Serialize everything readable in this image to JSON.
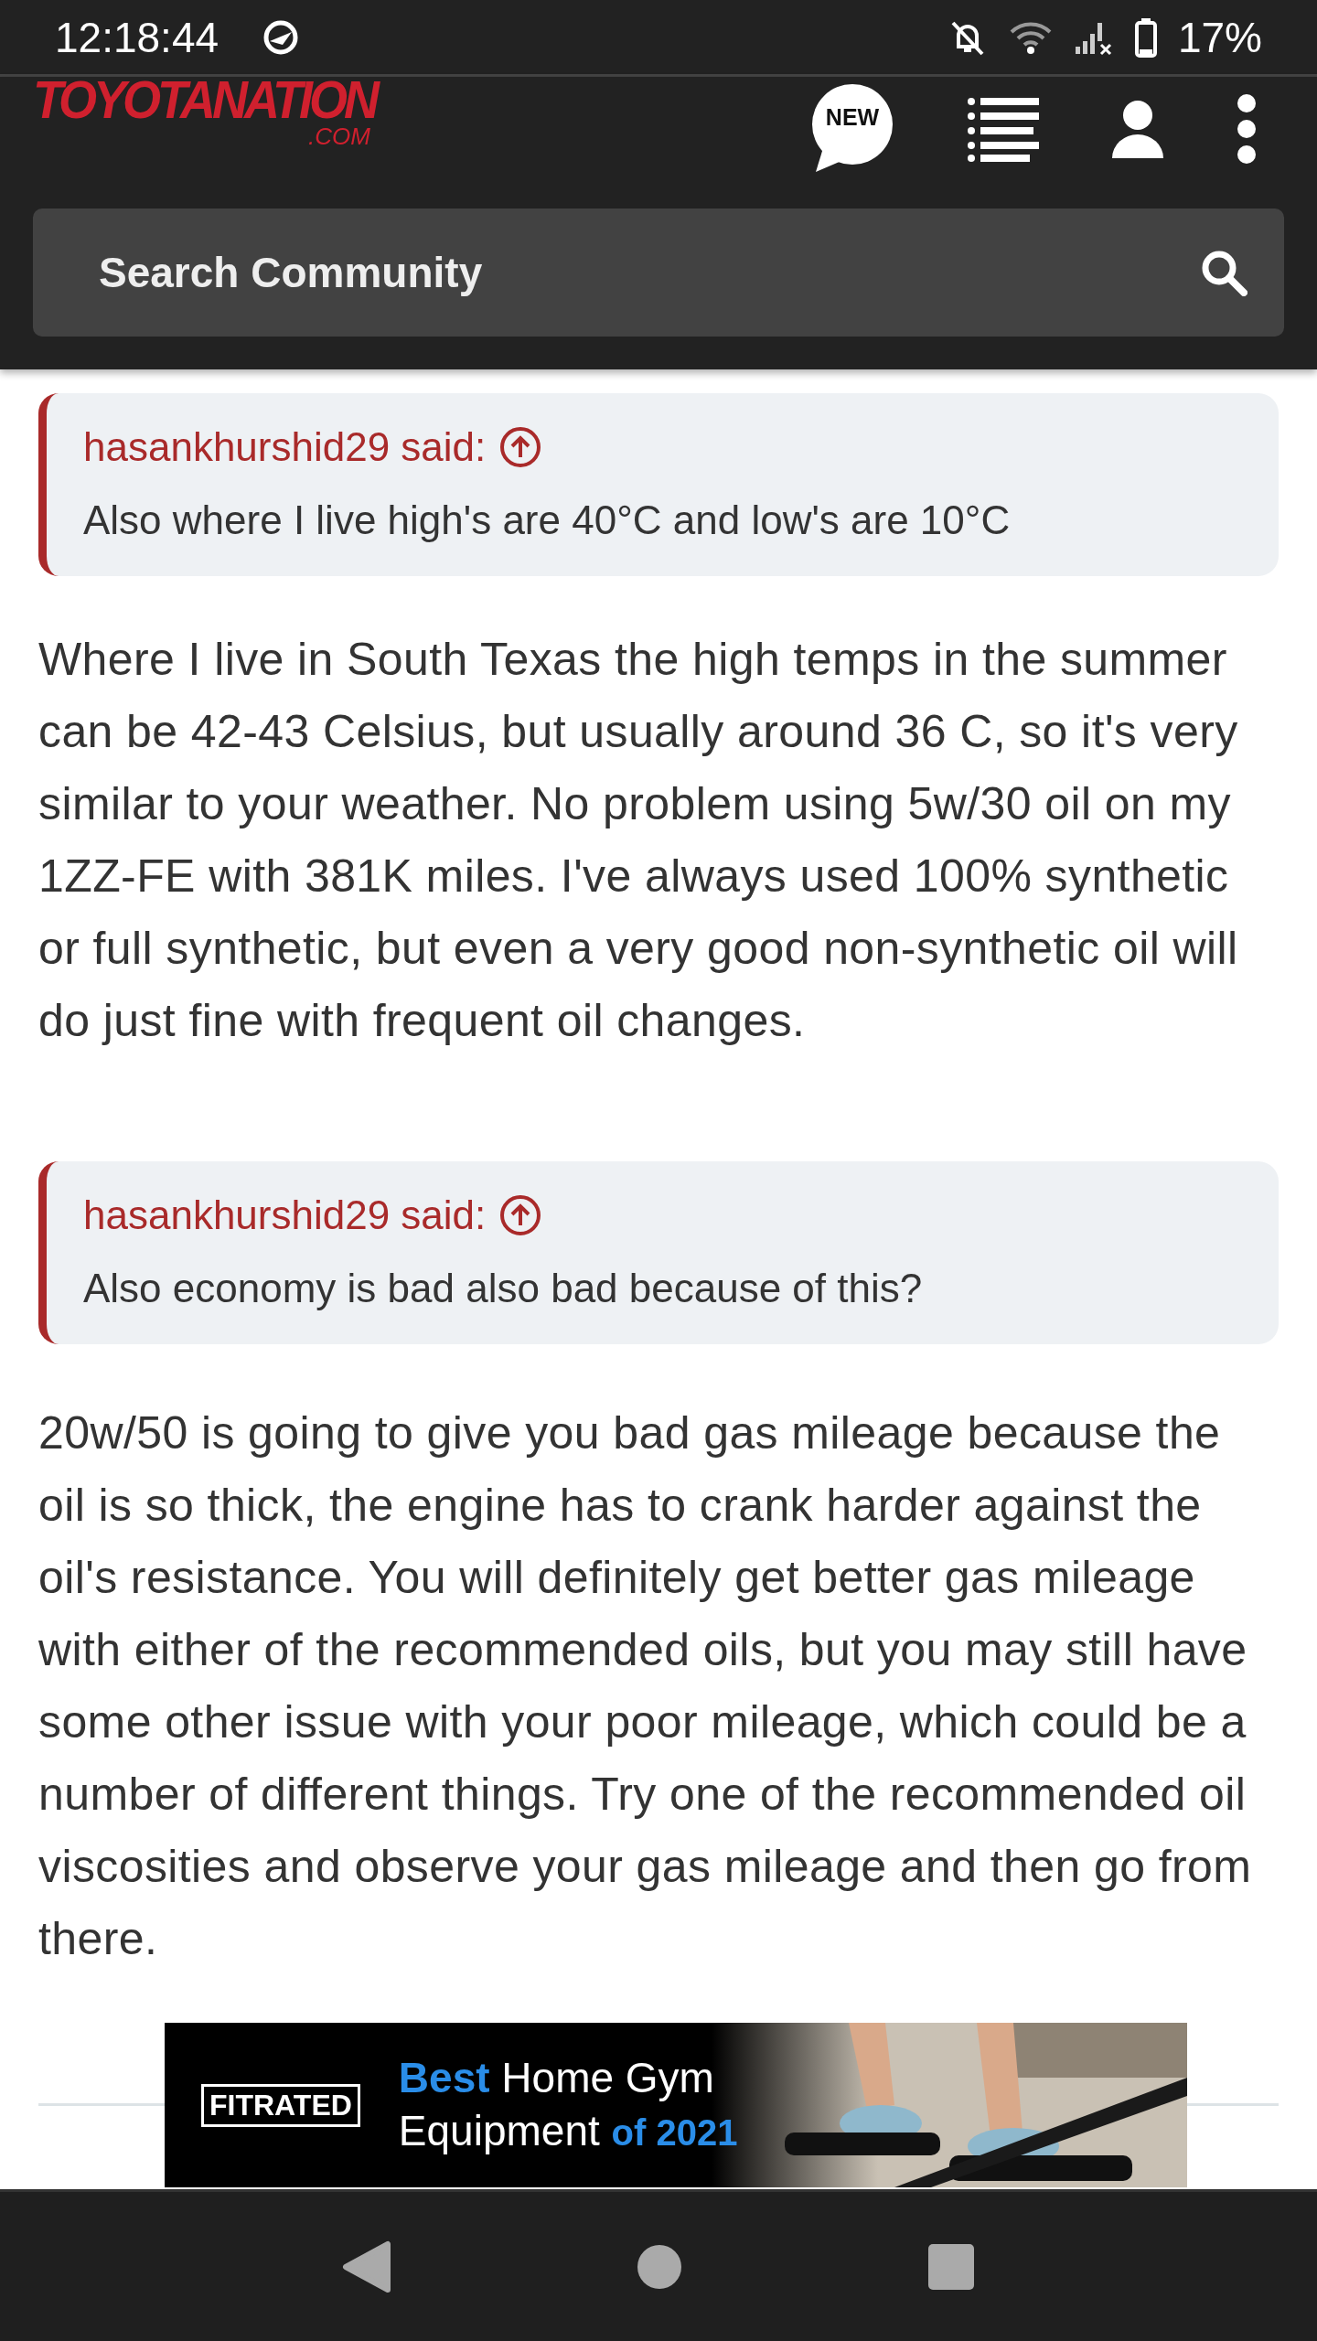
{
  "status_bar": {
    "time": "12:18:44",
    "battery": "17%"
  },
  "header": {
    "logo": "TOYOTANATION",
    "logo_suffix": ".COM",
    "new_badge": "NEW",
    "search": {
      "placeholder": "Search Community"
    }
  },
  "posts": [
    {
      "quote": {
        "author": "hasankhurshid29 said:",
        "text": "Also where I live high's are 40°C and low's are 10°C"
      },
      "reply": "Where I live in South Texas the high temps in the summer can be 42-43 Celsius, but usually around 36 C, so it's very similar to your weather. No problem using 5w/30 oil on my 1ZZ-FE with 381K miles. I've always used 100% synthetic or full synthetic, but even a very good non-synthetic oil will do just fine with frequent oil changes."
    },
    {
      "quote": {
        "author": "hasankhurshid29 said:",
        "text": "Also economy is bad also bad because of this?"
      },
      "reply": "20w/50 is going to give you bad gas mileage because the oil is so thick, the engine has to crank harder against the oil's resistance. You will definitely get better gas mileage with either of the recommended oils, but you may still have some other issue with your poor mileage, which could be a number of different things. Try one of the recommended oil viscosities and observe your gas mileage and then go from there."
    }
  ],
  "ad": {
    "brand": "FITRATED",
    "headline_bold": "Best",
    "headline": "Home Gym",
    "line2": "Equipment",
    "line2_accent": "of 2021"
  }
}
